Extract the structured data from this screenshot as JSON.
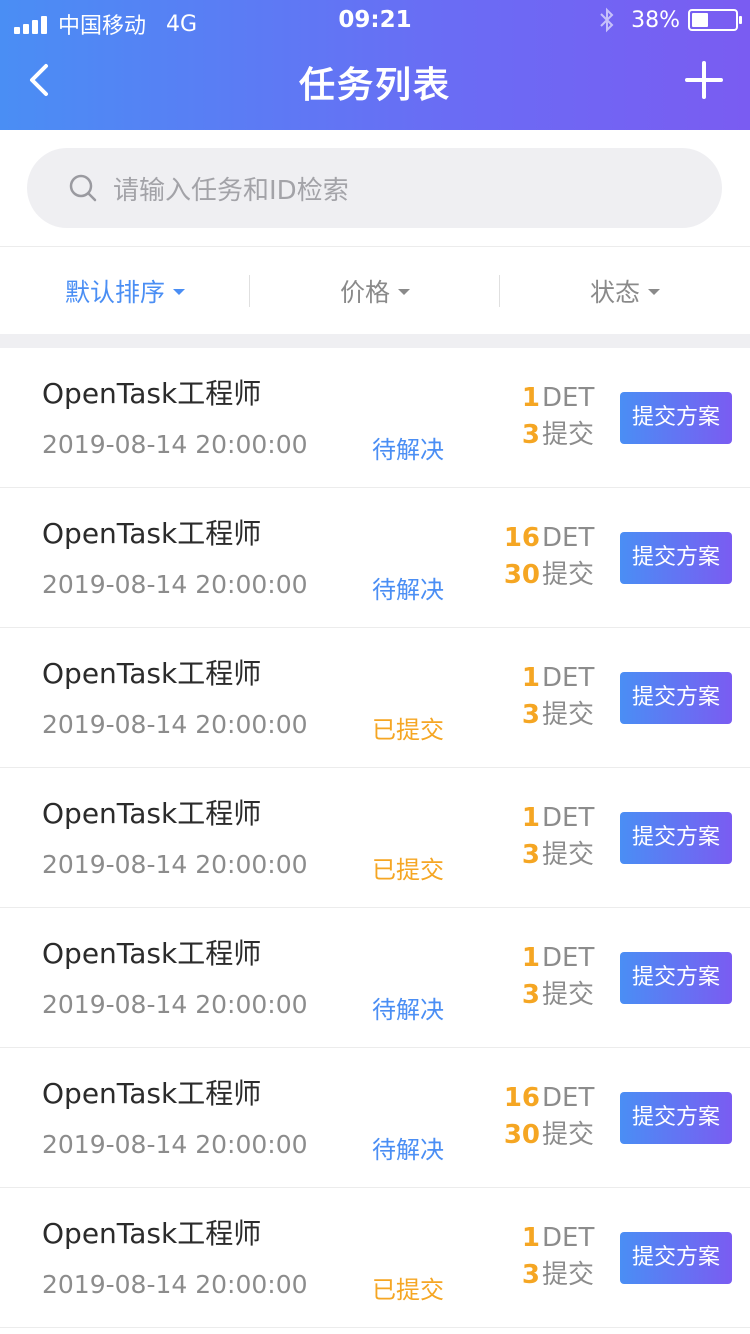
{
  "status_bar": {
    "carrier": "中国移动",
    "network": "4G",
    "time": "09:21",
    "battery": "38%"
  },
  "nav": {
    "title": "任务列表",
    "back_icon": "chevron-left-icon",
    "add_icon": "plus-icon"
  },
  "search": {
    "placeholder": "请输入任务和ID检索"
  },
  "filters": [
    {
      "label": "默认排序",
      "active": true
    },
    {
      "label": "价格",
      "active": false
    },
    {
      "label": "状态",
      "active": false
    }
  ],
  "colors": {
    "accent": "#4a8ef4",
    "accent_end": "#7a5cf2",
    "orange": "#f5a623",
    "pending_blue": "#4a8ef4"
  },
  "tasks": [
    {
      "title": "OpenTask工程师",
      "date": "2019-08-14 20:00:00",
      "status": "待解决",
      "status_type": "pending",
      "det": "1",
      "det_unit": "DET",
      "submits": "3",
      "submit_unit": "提交",
      "action": "提交方案"
    },
    {
      "title": "OpenTask工程师",
      "date": "2019-08-14 20:00:00",
      "status": "待解决",
      "status_type": "pending",
      "det": "16",
      "det_unit": "DET",
      "submits": "30",
      "submit_unit": "提交",
      "action": "提交方案"
    },
    {
      "title": "OpenTask工程师",
      "date": "2019-08-14 20:00:00",
      "status": "已提交",
      "status_type": "submitted",
      "det": "1",
      "det_unit": "DET",
      "submits": "3",
      "submit_unit": "提交",
      "action": "提交方案"
    },
    {
      "title": "OpenTask工程师",
      "date": "2019-08-14 20:00:00",
      "status": "已提交",
      "status_type": "submitted",
      "det": "1",
      "det_unit": "DET",
      "submits": "3",
      "submit_unit": "提交",
      "action": "提交方案"
    },
    {
      "title": "OpenTask工程师",
      "date": "2019-08-14 20:00:00",
      "status": "待解决",
      "status_type": "pending",
      "det": "1",
      "det_unit": "DET",
      "submits": "3",
      "submit_unit": "提交",
      "action": "提交方案"
    },
    {
      "title": "OpenTask工程师",
      "date": "2019-08-14 20:00:00",
      "status": "待解决",
      "status_type": "pending",
      "det": "16",
      "det_unit": "DET",
      "submits": "30",
      "submit_unit": "提交",
      "action": "提交方案"
    },
    {
      "title": "OpenTask工程师",
      "date": "2019-08-14 20:00:00",
      "status": "已提交",
      "status_type": "submitted",
      "det": "1",
      "det_unit": "DET",
      "submits": "3",
      "submit_unit": "提交",
      "action": "提交方案"
    }
  ]
}
